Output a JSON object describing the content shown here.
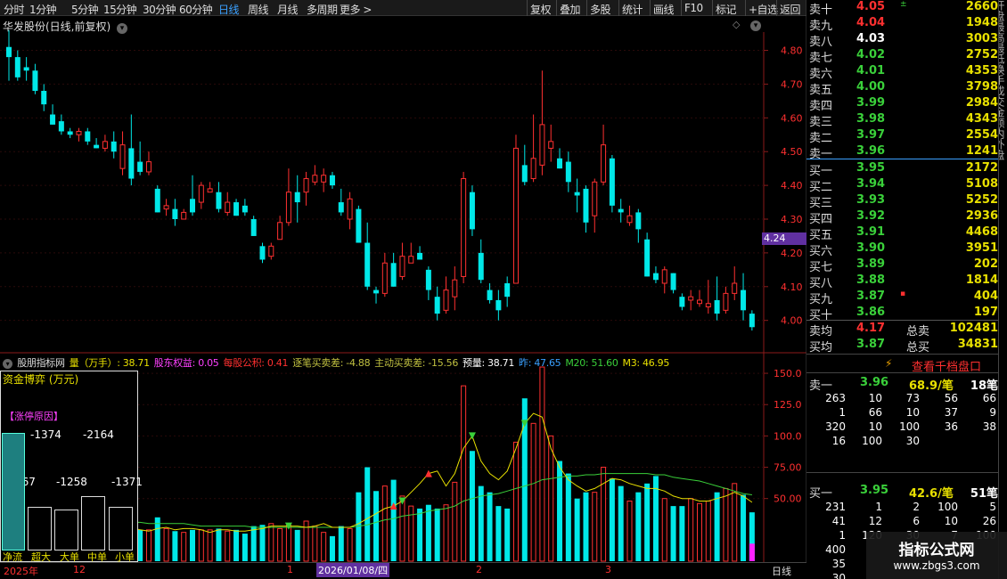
{
  "toolbar": {
    "periods": [
      "分时",
      "1分钟",
      "5分钟",
      "15分钟",
      "30分钟",
      "60分钟",
      "日线",
      "周线",
      "月线",
      "多周期",
      "更多 >"
    ],
    "active": "日线",
    "actions": [
      "复权",
      "叠加",
      "多股",
      "统计",
      "画线",
      "F10",
      "标记",
      "+自选",
      "返回"
    ]
  },
  "stock": {
    "title": "华发股份(日线,前复权)"
  },
  "price_axis": [
    "4.80",
    "4.70",
    "4.60",
    "4.50",
    "4.40",
    "4.30",
    "4.20",
    "4.10",
    "4.00"
  ],
  "current_price": "4.24",
  "volume_axis": [
    "150.0",
    "125.0",
    "100.0",
    "75.00",
    "50.00"
  ],
  "indicator_header": [
    {
      "text": "股朋指标网",
      "color": "#ddd"
    },
    {
      "text": "量（万手）: 38.71",
      "color": "#e8e000"
    },
    {
      "text": "股东权益: 0.05",
      "color": "#ff40ff"
    },
    {
      "text": "每股公积: 0.41",
      "color": "#ff3030"
    },
    {
      "text": "逐笔买卖差: -4.88",
      "color": "#c0c040"
    },
    {
      "text": "主动买卖差: -15.56",
      "color": "#c0c040"
    },
    {
      "text": "预量: 38.71",
      "color": "#fff"
    },
    {
      "text": "昨: 47.65",
      "color": "#3aa0ff"
    },
    {
      "text": "M20: 51.60",
      "color": "#3ad03a"
    },
    {
      "text": "M3: 46.95",
      "color": "#e8e000"
    }
  ],
  "capital_panel": {
    "title": "资金博弈 (万元)",
    "reason": "【涨停原因】",
    "values": [
      "-1374",
      "-2164",
      "-6167",
      "-1258",
      "-1371"
    ],
    "labels": [
      "净流",
      "超大",
      "大单",
      "中单",
      "小单"
    ]
  },
  "date_axis": {
    "year": "2025年",
    "m12": "12",
    "m1": "1",
    "selected": "2026/01/08/四",
    "m2": "2",
    "m3": "3",
    "period": "日线"
  },
  "orderbook": {
    "asks": [
      {
        "label": "卖十",
        "price": "4.05",
        "vol": "2660",
        "color": "r",
        "flag": "±"
      },
      {
        "label": "卖九",
        "price": "4.04",
        "vol": "1948",
        "color": "r"
      },
      {
        "label": "卖八",
        "price": "4.03",
        "vol": "3003",
        "color": "w"
      },
      {
        "label": "卖七",
        "price": "4.02",
        "vol": "2752",
        "color": "g"
      },
      {
        "label": "卖六",
        "price": "4.01",
        "vol": "4353",
        "color": "g"
      },
      {
        "label": "卖五",
        "price": "4.00",
        "vol": "3798",
        "color": "g"
      },
      {
        "label": "卖四",
        "price": "3.99",
        "vol": "2984",
        "color": "g"
      },
      {
        "label": "卖三",
        "price": "3.98",
        "vol": "4343",
        "color": "g"
      },
      {
        "label": "卖二",
        "price": "3.97",
        "vol": "2554",
        "color": "g"
      },
      {
        "label": "卖一",
        "price": "3.96",
        "vol": "1241",
        "color": "g"
      }
    ],
    "bids": [
      {
        "label": "买一",
        "price": "3.95",
        "vol": "2172",
        "color": "g"
      },
      {
        "label": "买二",
        "price": "3.94",
        "vol": "5108",
        "color": "g"
      },
      {
        "label": "买三",
        "price": "3.93",
        "vol": "5252",
        "color": "g"
      },
      {
        "label": "买四",
        "price": "3.92",
        "vol": "2936",
        "color": "g"
      },
      {
        "label": "买五",
        "price": "3.91",
        "vol": "4468",
        "color": "g"
      },
      {
        "label": "买六",
        "price": "3.90",
        "vol": "3951",
        "color": "g"
      },
      {
        "label": "买七",
        "price": "3.89",
        "vol": "202",
        "color": "g"
      },
      {
        "label": "买八",
        "price": "3.88",
        "vol": "1814",
        "color": "g"
      },
      {
        "label": "买九",
        "price": "3.87",
        "vol": "404",
        "color": "g",
        "flag": "▪"
      },
      {
        "label": "买十",
        "price": "3.86",
        "vol": "197",
        "color": "g"
      }
    ],
    "avg_sell": {
      "label": "卖均",
      "price": "4.17",
      "total_label": "总卖",
      "total": "102481"
    },
    "avg_buy": {
      "label": "买均",
      "price": "3.87",
      "total_label": "总买",
      "total": "34831"
    },
    "qianbang": "查看千档盘口",
    "sell1": {
      "label": "卖一",
      "price": "3.96",
      "avg": "68.9/笔",
      "count": "18笔"
    },
    "sell1_orders": [
      [
        "263",
        "10",
        "73",
        "56",
        "66"
      ],
      [
        "1",
        "66",
        "10",
        "37",
        "9"
      ],
      [
        "320",
        "10",
        "100",
        "36",
        "38"
      ],
      [
        "16",
        "100",
        "30",
        "",
        ""
      ]
    ],
    "buy1": {
      "label": "买一",
      "price": "3.95",
      "avg": "42.6/笔",
      "count": "51笔"
    },
    "buy1_orders": [
      [
        "231",
        "1",
        "2",
        "100",
        "5"
      ],
      [
        "41",
        "12",
        "6",
        "10",
        "26"
      ],
      [
        "1",
        "120",
        "30",
        "7",
        "100"
      ],
      [
        "400",
        "",
        "",
        "",
        ""
      ],
      [
        "35",
        "",
        "",
        "",
        ""
      ],
      [
        "30",
        "",
        "",
        "",
        ""
      ]
    ]
  },
  "side_strip": "开盘最高最低换手成交金额内外盘",
  "watermark": {
    "title": "指标公式网",
    "url": "www.zbgs3.com"
  },
  "chart_data": {
    "type": "candlestick",
    "ylim": [
      3.92,
      4.87
    ],
    "volume_ylim": [
      0,
      160
    ],
    "candles": [
      [
        4.81,
        4.78,
        4.86,
        4.71
      ],
      [
        4.78,
        4.72,
        4.8,
        4.71
      ],
      [
        4.75,
        4.74,
        4.78,
        4.71
      ],
      [
        4.74,
        4.68,
        4.76,
        4.67
      ],
      [
        4.68,
        4.64,
        4.7,
        4.62
      ],
      [
        4.61,
        4.58,
        4.64,
        4.58
      ],
      [
        4.59,
        4.56,
        4.61,
        4.55
      ],
      [
        4.56,
        4.55,
        4.57,
        4.54
      ],
      [
        4.55,
        4.56,
        4.57,
        4.53
      ],
      [
        4.56,
        4.53,
        4.57,
        4.52
      ],
      [
        4.52,
        4.51,
        4.54,
        4.51
      ],
      [
        4.51,
        4.53,
        4.55,
        4.5
      ],
      [
        4.53,
        4.5,
        4.56,
        4.48
      ],
      [
        4.45,
        4.52,
        4.56,
        4.43
      ],
      [
        4.51,
        4.42,
        4.61,
        4.4
      ],
      [
        4.47,
        4.44,
        4.53,
        4.43
      ],
      [
        4.44,
        4.47,
        4.5,
        4.43
      ],
      [
        4.39,
        4.32,
        4.4,
        4.32
      ],
      [
        4.33,
        4.34,
        4.36,
        4.31
      ],
      [
        4.33,
        4.3,
        4.36,
        4.28
      ],
      [
        4.3,
        4.32,
        4.33,
        4.3
      ],
      [
        4.36,
        4.32,
        4.43,
        4.31
      ],
      [
        4.35,
        4.4,
        4.41,
        4.33
      ],
      [
        4.38,
        4.39,
        4.41,
        4.38
      ],
      [
        4.38,
        4.33,
        4.41,
        4.32
      ],
      [
        4.32,
        4.35,
        4.38,
        4.31
      ],
      [
        4.35,
        4.31,
        4.36,
        4.31
      ],
      [
        4.34,
        4.32,
        4.36,
        4.31
      ],
      [
        4.3,
        4.25,
        4.31,
        4.25
      ],
      [
        4.22,
        4.18,
        4.23,
        4.17
      ],
      [
        4.19,
        4.22,
        4.23,
        4.18
      ],
      [
        4.24,
        4.29,
        4.31,
        4.24
      ],
      [
        4.29,
        4.38,
        4.45,
        4.28
      ],
      [
        4.38,
        4.35,
        4.43,
        4.29
      ],
      [
        4.38,
        4.42,
        4.44,
        4.34
      ],
      [
        4.41,
        4.43,
        4.46,
        4.4
      ],
      [
        4.41,
        4.43,
        4.45,
        4.38
      ],
      [
        4.43,
        4.4,
        4.44,
        4.39
      ],
      [
        4.35,
        4.32,
        4.39,
        4.31
      ],
      [
        4.3,
        4.36,
        4.38,
        4.27
      ],
      [
        4.33,
        4.23,
        4.34,
        4.23
      ],
      [
        4.23,
        4.1,
        4.29,
        4.09
      ],
      [
        4.09,
        4.08,
        4.1,
        4.05
      ],
      [
        4.08,
        4.17,
        4.2,
        4.07
      ],
      [
        4.17,
        4.1,
        4.2,
        4.1
      ],
      [
        4.13,
        4.19,
        4.23,
        4.12
      ],
      [
        4.17,
        4.19,
        4.23,
        4.17
      ],
      [
        4.2,
        4.18,
        4.22,
        4.18
      ],
      [
        4.15,
        4.09,
        4.16,
        4.06
      ],
      [
        4.07,
        4.02,
        4.1,
        4.0
      ],
      [
        4.03,
        4.09,
        4.13,
        4.02
      ],
      [
        4.07,
        4.12,
        4.16,
        4.03
      ],
      [
        4.13,
        4.42,
        4.44,
        4.11
      ],
      [
        4.38,
        4.27,
        4.4,
        4.25
      ],
      [
        4.2,
        4.12,
        4.24,
        4.11
      ],
      [
        4.09,
        4.06,
        4.11,
        4.05
      ],
      [
        4.06,
        4.03,
        4.09,
        4.0
      ],
      [
        4.11,
        4.07,
        4.13,
        4.04
      ],
      [
        4.11,
        4.51,
        4.55,
        4.11
      ],
      [
        4.46,
        4.41,
        4.52,
        4.4
      ],
      [
        4.42,
        4.48,
        4.61,
        4.41
      ],
      [
        4.46,
        4.58,
        4.74,
        4.43
      ],
      [
        4.51,
        4.53,
        4.58,
        4.47
      ],
      [
        4.48,
        4.45,
        4.51,
        4.45
      ],
      [
        4.47,
        4.41,
        4.5,
        4.38
      ],
      [
        4.38,
        4.37,
        4.42,
        4.32
      ],
      [
        4.39,
        4.29,
        4.4,
        4.26
      ],
      [
        4.31,
        4.41,
        4.42,
        4.26
      ],
      [
        4.41,
        4.52,
        4.58,
        4.4
      ],
      [
        4.48,
        4.34,
        4.49,
        4.32
      ],
      [
        4.33,
        4.32,
        4.36,
        4.29
      ],
      [
        4.29,
        4.31,
        4.34,
        4.28
      ],
      [
        4.32,
        4.27,
        4.33,
        4.23
      ],
      [
        4.24,
        4.13,
        4.26,
        4.13
      ],
      [
        4.14,
        4.12,
        4.16,
        4.11
      ],
      [
        4.11,
        4.15,
        4.16,
        4.08
      ],
      [
        4.14,
        4.09,
        4.14,
        4.08
      ],
      [
        4.07,
        4.04,
        4.08,
        4.03
      ],
      [
        4.06,
        4.07,
        4.09,
        4.03
      ],
      [
        4.05,
        4.06,
        4.09,
        4.04
      ],
      [
        4.04,
        4.05,
        4.12,
        4.02
      ],
      [
        4.06,
        4.02,
        4.13,
        4.0
      ],
      [
        4.03,
        4.08,
        4.1,
        4.02
      ],
      [
        4.08,
        4.11,
        4.16,
        4.06
      ],
      [
        4.09,
        4.03,
        4.14,
        4.0
      ],
      [
        4.02,
        3.98,
        4.03,
        3.97
      ]
    ],
    "volume": [
      35,
      33,
      30,
      30,
      27,
      28,
      27,
      26,
      26,
      24,
      26,
      25,
      27,
      23,
      31,
      25,
      25,
      35,
      26,
      24,
      23,
      25,
      25,
      25,
      26,
      24,
      25,
      22,
      28,
      29,
      30,
      26,
      30,
      25,
      32,
      28,
      23,
      20,
      28,
      26,
      55,
      75,
      56,
      60,
      65,
      52,
      44,
      42,
      45,
      42,
      45,
      63,
      140,
      88,
      60,
      55,
      44,
      42,
      95,
      130,
      110,
      155,
      100,
      80,
      70,
      50,
      55,
      55,
      75,
      66,
      60,
      48,
      55,
      62,
      68,
      50,
      44,
      44,
      50,
      46,
      48,
      55,
      58,
      62,
      53,
      39
    ],
    "m3": [
      55,
      50,
      45,
      40,
      38,
      35,
      30,
      28,
      30,
      27,
      26,
      27,
      25,
      25,
      27,
      25,
      24,
      26,
      27,
      25,
      26,
      26,
      25,
      23,
      25,
      25,
      24,
      24,
      25,
      26,
      28,
      28,
      28,
      28,
      27,
      28,
      30,
      27,
      27,
      27,
      30,
      34,
      38,
      42,
      44,
      48,
      55,
      62,
      70,
      72,
      60,
      70,
      90,
      100,
      80,
      70,
      65,
      72,
      90,
      110,
      118,
      115,
      90,
      75,
      65,
      60,
      56,
      58,
      62,
      66,
      65,
      62,
      60,
      58,
      58,
      56,
      52,
      50,
      50,
      48,
      48,
      50,
      52,
      55,
      52,
      47
    ],
    "m20": [
      40,
      40,
      39,
      38,
      38,
      38,
      37,
      37,
      36,
      35,
      34,
      33,
      32,
      32,
      31,
      31,
      30,
      30,
      30,
      30,
      30,
      29,
      28,
      28,
      28,
      28,
      28,
      28,
      27,
      27,
      27,
      27,
      27,
      27,
      27,
      27,
      27,
      27,
      27,
      27,
      28,
      29,
      31,
      33,
      34,
      36,
      37,
      38,
      40,
      41,
      42,
      44,
      48,
      50,
      52,
      53,
      54,
      56,
      58,
      60,
      62,
      65,
      66,
      67,
      68,
      68,
      69,
      69,
      70,
      70,
      70,
      70,
      70,
      70,
      69,
      69,
      67,
      66,
      65,
      64,
      62,
      60,
      58,
      56,
      54,
      53
    ],
    "markers": [
      {
        "i": 32,
        "color": "#3ad03a",
        "dir": "down"
      },
      {
        "i": 44,
        "color": "#ff3030",
        "dir": "up"
      },
      {
        "i": 45,
        "color": "#3ad03a",
        "dir": "down"
      },
      {
        "i": 48,
        "color": "#ff3030",
        "dir": "up"
      },
      {
        "i": 53,
        "color": "#3ad03a",
        "dir": "down"
      },
      {
        "i": 59,
        "color": "#3ad03a",
        "dir": "down"
      }
    ]
  }
}
